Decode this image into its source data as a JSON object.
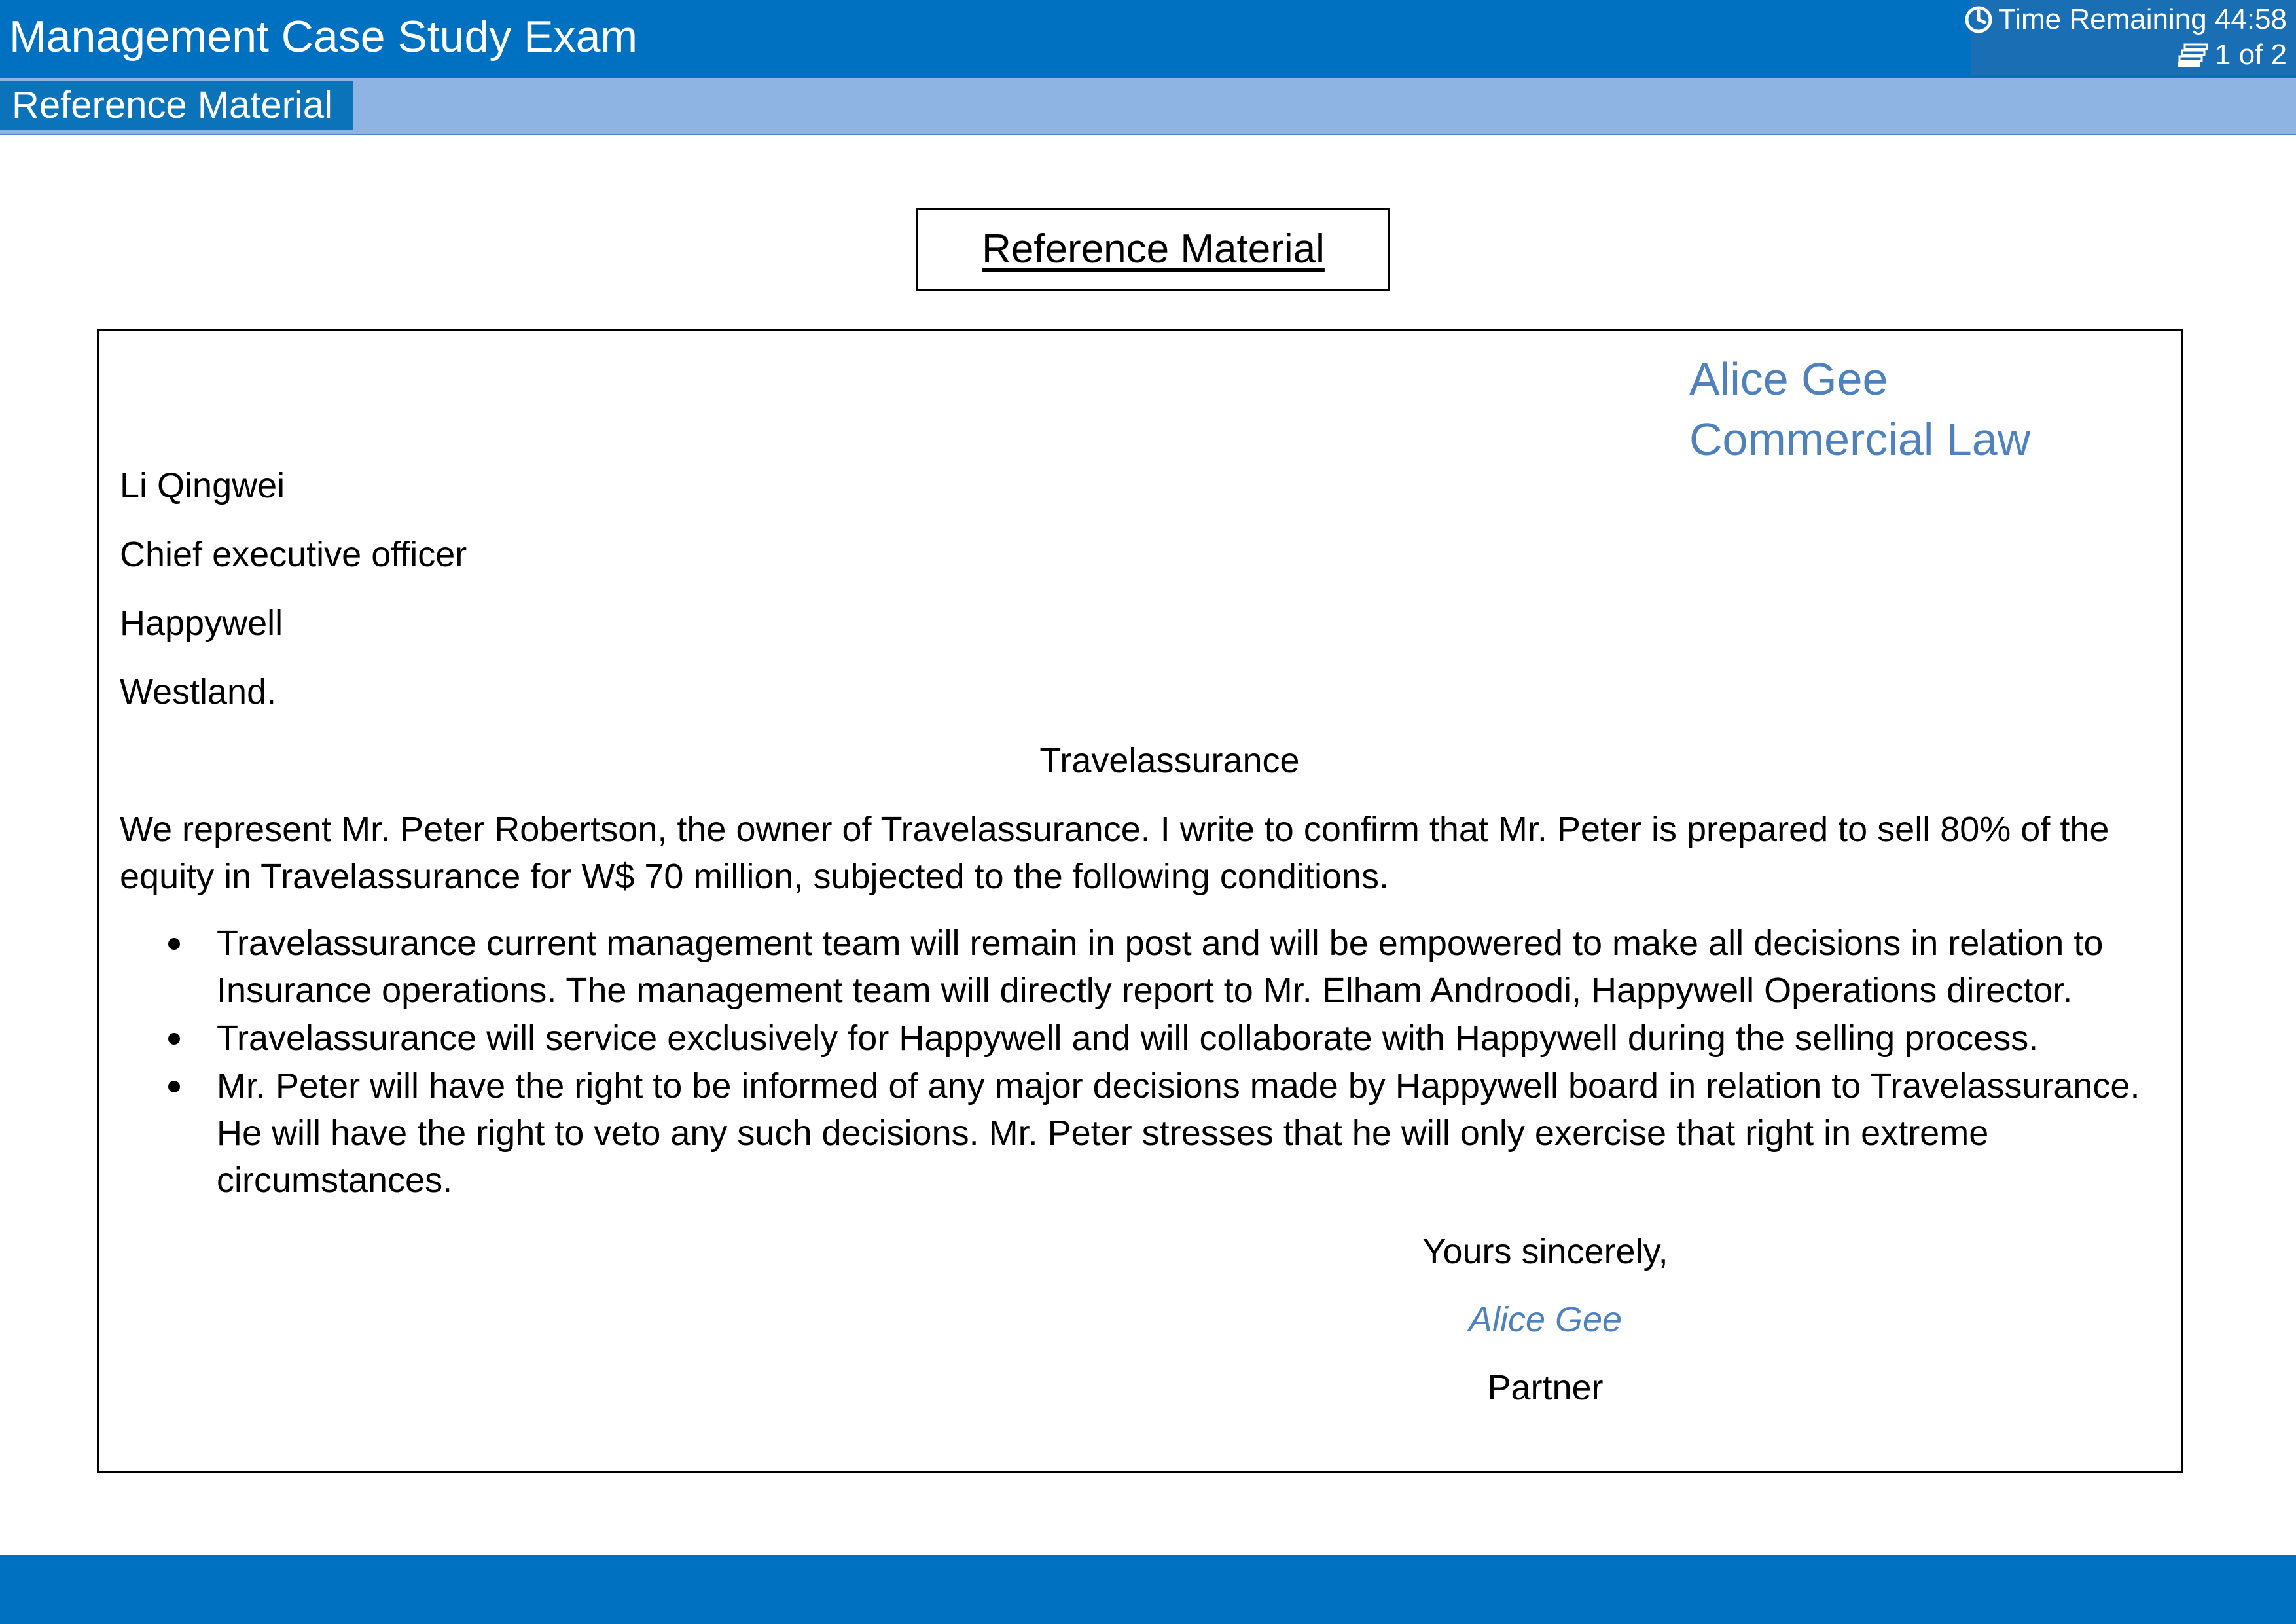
{
  "header": {
    "title": "Management Case Study Exam",
    "time_remaining": "Time Remaining 44:58",
    "page_indicator": "1 of 2"
  },
  "subbar": {
    "tab_label": "Reference Material"
  },
  "reference_heading": "Reference Material",
  "letter": {
    "sender_name": "Alice Gee",
    "sender_firm": "Commercial Law",
    "recipient_name": "Li Qingwei",
    "recipient_title": "Chief executive officer",
    "recipient_company": "Happywell",
    "recipient_location": "Westland.",
    "subject": "Travelassurance",
    "body": "We represent Mr. Peter Robertson, the owner of Travelassurance. I write to confirm that Mr. Peter is prepared to sell 80% of the equity in Travelassurance for W$ 70 million, subjected to the following conditions.",
    "conditions": [
      "Travelassurance current management team will remain in post and will be empowered to make all decisions in relation to Insurance operations. The management team will directly report to Mr. Elham Androodi, Happywell Operations director.",
      "Travelassurance will service exclusively for Happywell and will collaborate with Happywell during the selling process.",
      "Mr. Peter will have the right to be informed of any major decisions made by Happywell board in relation to Travelassurance. He will have the right to veto any such decisions. Mr. Peter stresses that he will only exercise that right in extreme circumstances."
    ],
    "closing": "Yours sincerely,",
    "signature": "Alice Gee",
    "signer_role": "Partner"
  },
  "colors": {
    "primary_blue": "#0070c0",
    "light_blue": "#8db4e2",
    "accent_text": "#4f81bd"
  },
  "icons": {
    "timer": "clock-icon",
    "pages": "pages-icon"
  }
}
